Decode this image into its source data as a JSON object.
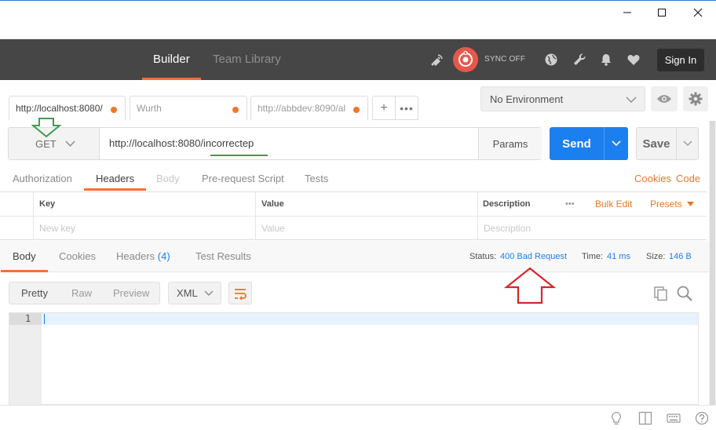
{
  "window": {
    "minimize_icon": "minimize-icon",
    "maximize_icon": "maximize-icon",
    "close_icon": "close-icon"
  },
  "header": {
    "tabs": [
      {
        "label": "Builder",
        "active": true
      },
      {
        "label": "Team Library",
        "active": false
      }
    ],
    "sync_label": "SYNC OFF",
    "sign_in": "Sign In",
    "icons": [
      "satellite-icon",
      "sync-icon",
      "globe-icon",
      "wrench-icon",
      "bell-icon",
      "heart-icon"
    ]
  },
  "request_tabs": [
    {
      "label": "http://localhost:8080/",
      "unsaved": true
    },
    {
      "label": "Wurth",
      "unsaved": true
    },
    {
      "label": "http://abbdev:8090/al",
      "unsaved": true
    }
  ],
  "environment": {
    "selected": "No Environment"
  },
  "request": {
    "method": "GET",
    "url": "http://localhost:8080/incorrectep",
    "params_label": "Params",
    "send_label": "Send",
    "save_label": "Save"
  },
  "request_sections": {
    "tabs": [
      {
        "label": "Authorization",
        "state": "normal"
      },
      {
        "label": "Headers",
        "state": "active"
      },
      {
        "label": "Body",
        "state": "disabled"
      },
      {
        "label": "Pre-request Script",
        "state": "normal"
      },
      {
        "label": "Tests",
        "state": "normal"
      }
    ],
    "cookies_link": "Cookies",
    "code_link": "Code"
  },
  "headers_table": {
    "columns": [
      "Key",
      "Value",
      "Description"
    ],
    "more": "•••",
    "bulk_edit": "Bulk Edit",
    "presets": "Presets",
    "placeholders": {
      "key": "New key",
      "value": "Value",
      "description": "Description"
    }
  },
  "response": {
    "tabs": [
      {
        "label": "Body",
        "active": true
      },
      {
        "label": "Cookies",
        "active": false
      },
      {
        "label": "Headers",
        "count": "(4)",
        "active": false
      },
      {
        "label": "Test Results",
        "active": false
      }
    ],
    "status_label": "Status:",
    "status_value": "400 Bad Request",
    "time_label": "Time:",
    "time_value": "41 ms",
    "size_label": "Size:",
    "size_value": "146 B",
    "view_modes": [
      "Pretty",
      "Raw",
      "Preview"
    ],
    "active_view": "Pretty",
    "format": "XML",
    "editor_line": "1"
  },
  "footer": {
    "icons": [
      "bulb-icon",
      "two-pane-icon",
      "keyboard-icon",
      "help-icon"
    ]
  },
  "colors": {
    "accent": "#ff6c37",
    "link": "#1c7ff0",
    "header_bg": "#464646",
    "annotation_green": "#3d9c4c",
    "annotation_red": "#d9242a"
  }
}
